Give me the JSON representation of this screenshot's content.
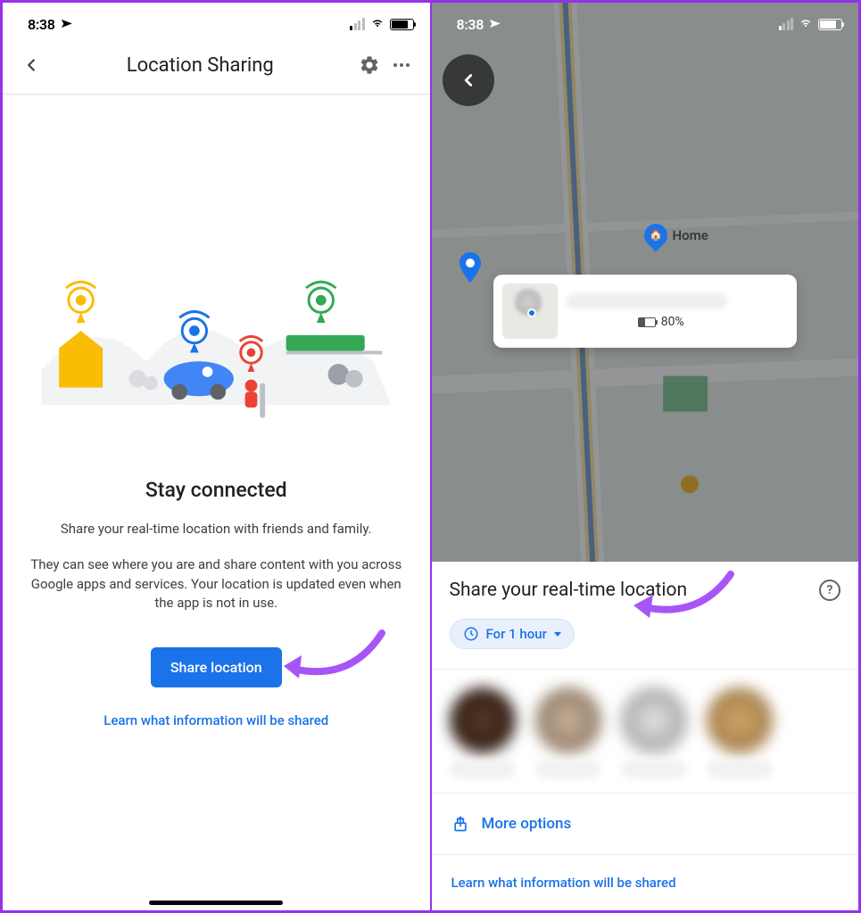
{
  "left": {
    "status": {
      "time": "8:38"
    },
    "header": {
      "title": "Location Sharing"
    },
    "heading": "Stay connected",
    "sub1": "Share your real-time location with friends and family.",
    "sub2": "They can see where you are and share content with you across Google apps and services. Your location is updated even when the app is not in use.",
    "share_button": "Share location",
    "learn_link": "Learn what information will be shared"
  },
  "right": {
    "status": {
      "time": "8:38"
    },
    "home_label": "Home",
    "info_battery": "80%",
    "sheet": {
      "title": "Share your real-time location",
      "duration_chip": "For 1 hour",
      "more_options": "More options",
      "learn_link": "Learn what information will be shared"
    }
  }
}
